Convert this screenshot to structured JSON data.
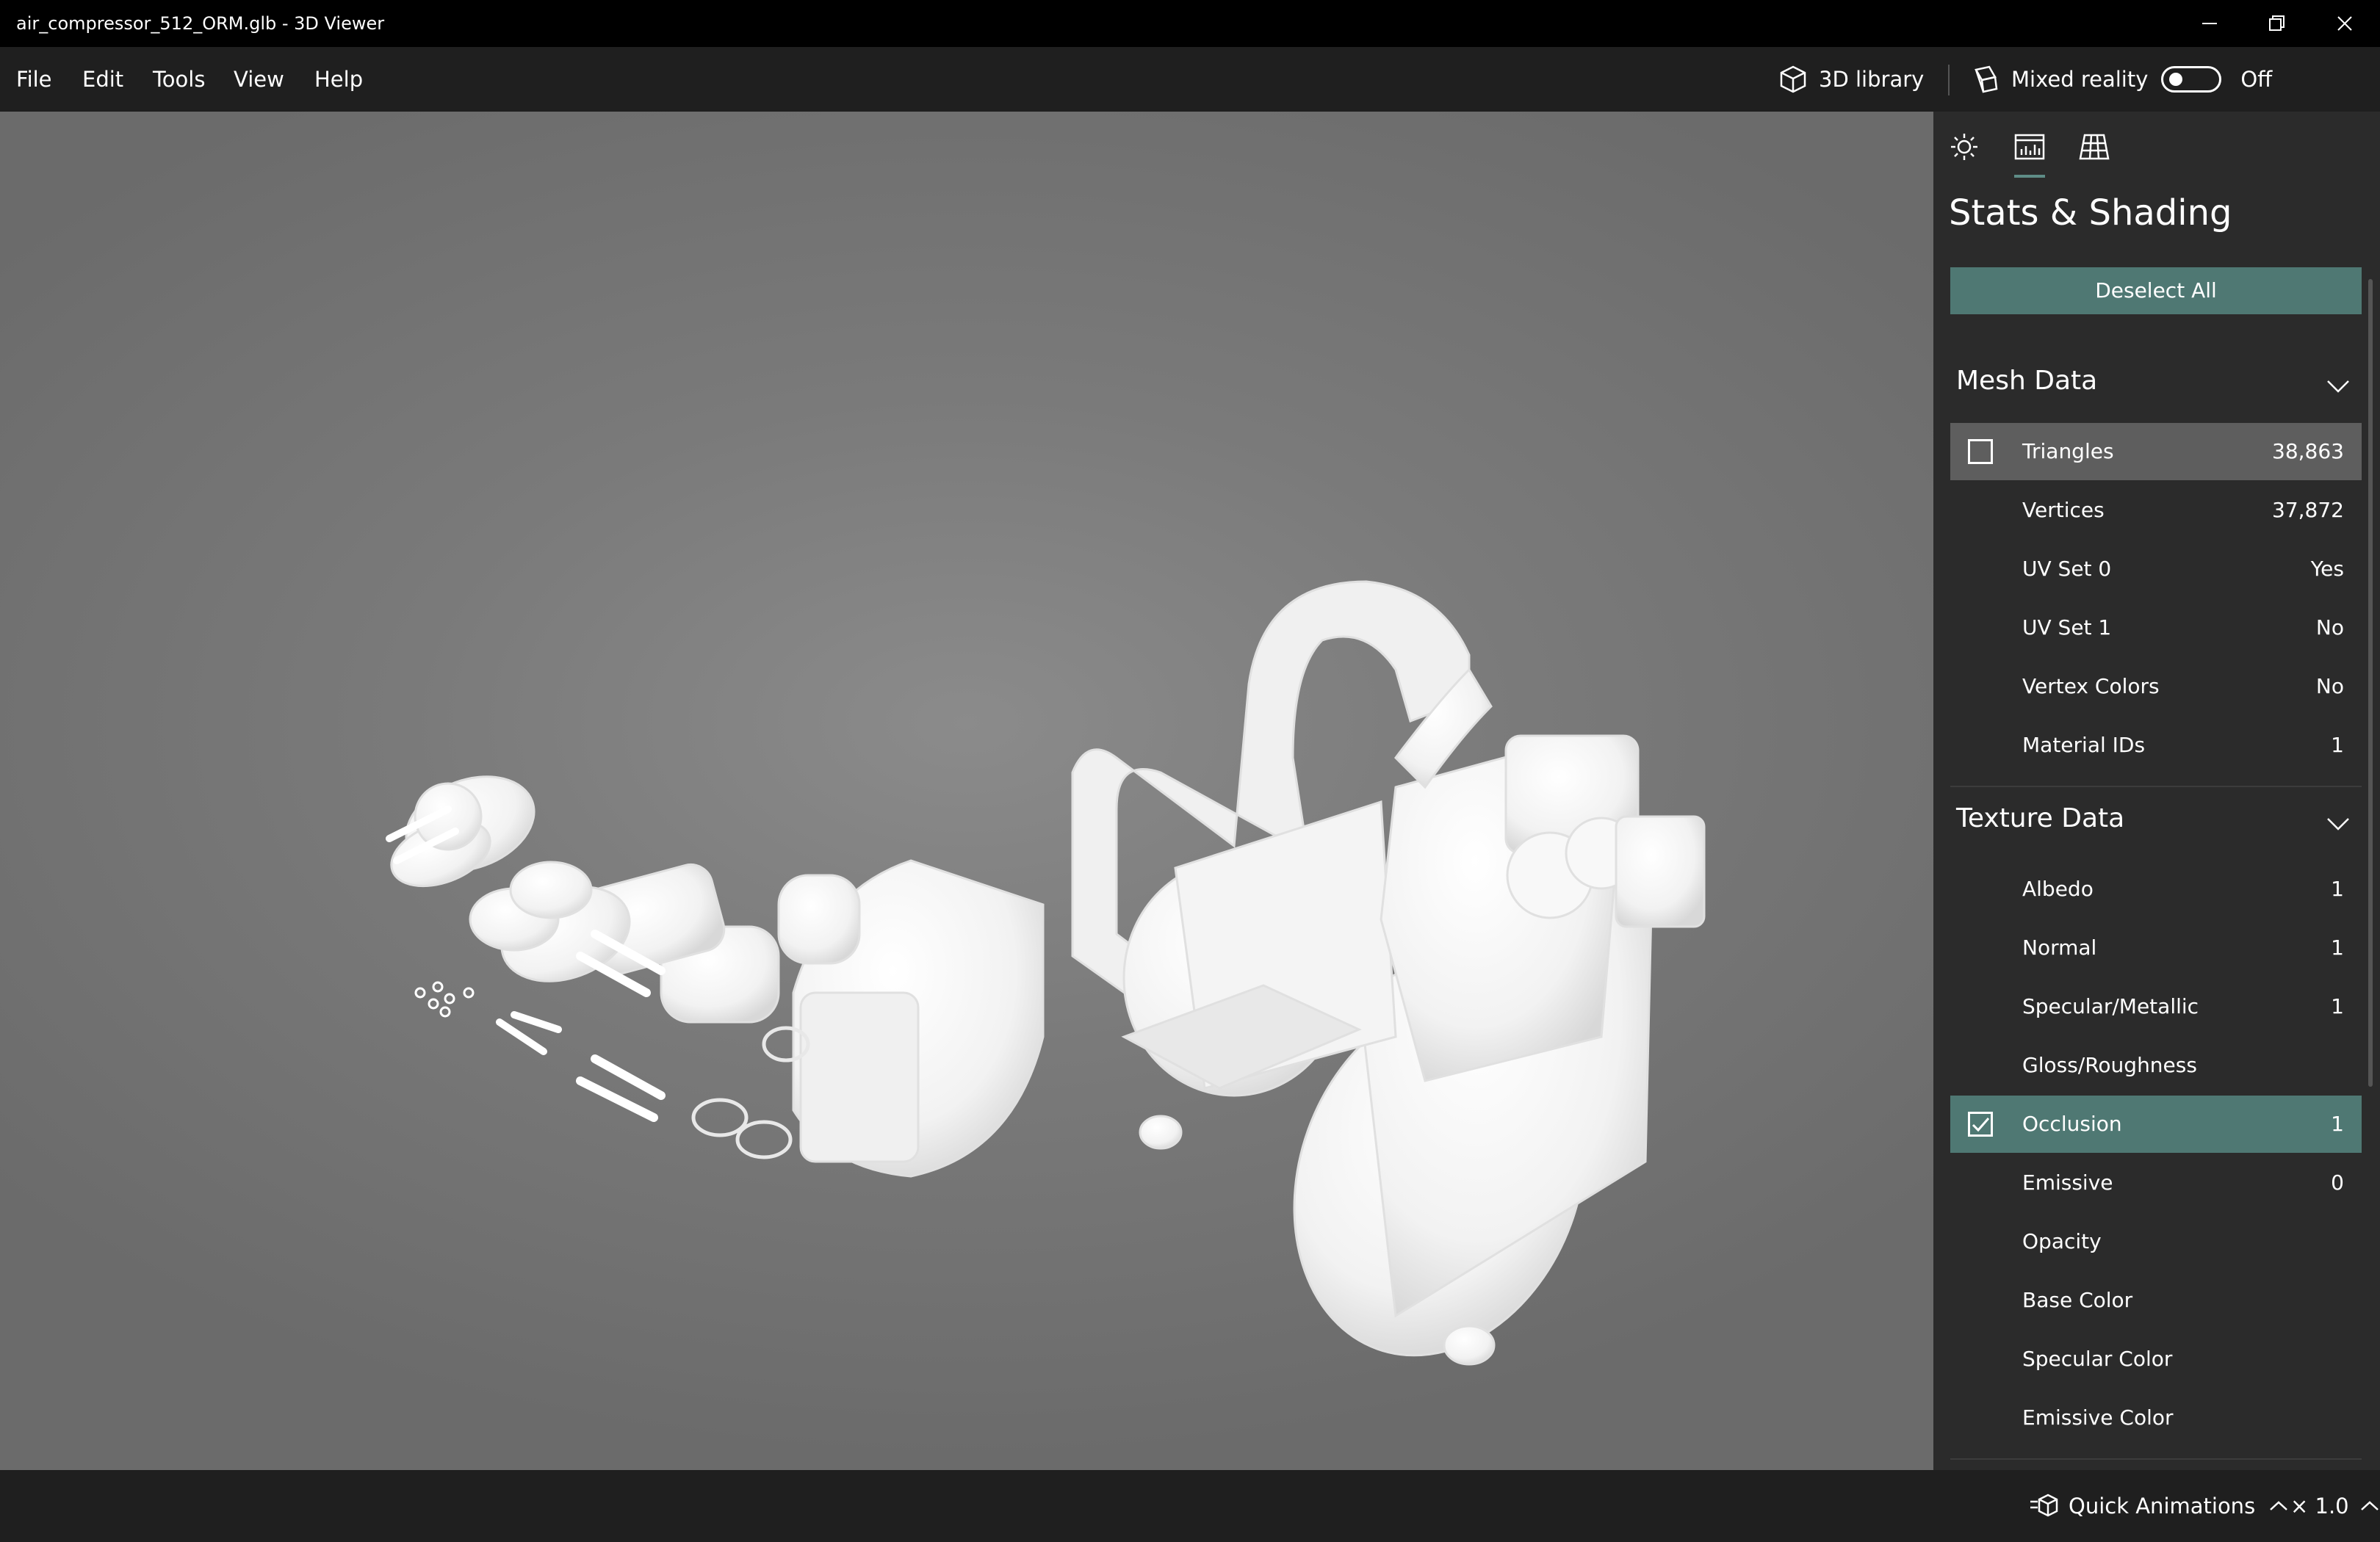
{
  "window": {
    "title": "air_compressor_512_ORM.glb - 3D Viewer",
    "controls": [
      "minimize-icon",
      "restore-icon",
      "close-icon"
    ]
  },
  "menu": {
    "file": "File",
    "edit": "Edit",
    "tools": "Tools",
    "view": "View",
    "help": "Help"
  },
  "toolbar": {
    "library_label": "3D library",
    "mixed_reality_label": "Mixed reality",
    "mixed_reality_state": "Off"
  },
  "panel": {
    "tabs": [
      "sun-icon",
      "stats-icon",
      "grid-icon"
    ],
    "active_tab": "stats-icon",
    "title": "Stats & Shading",
    "deselect_label": "Deselect All",
    "mesh": {
      "header": "Mesh Data",
      "rows": [
        {
          "label": "Triangles",
          "value": "38,863",
          "checkbox": true,
          "checked": false,
          "state": "hover"
        },
        {
          "label": "Vertices",
          "value": "37,872"
        },
        {
          "label": "UV Set 0",
          "value": "Yes"
        },
        {
          "label": "UV Set 1",
          "value": "No"
        },
        {
          "label": "Vertex Colors",
          "value": "No"
        },
        {
          "label": "Material IDs",
          "value": "1"
        }
      ]
    },
    "texture": {
      "header": "Texture Data",
      "rows": [
        {
          "label": "Albedo",
          "value": "1"
        },
        {
          "label": "Normal",
          "value": "1"
        },
        {
          "label": "Specular/Metallic",
          "value": "1"
        },
        {
          "label": "Gloss/Roughness",
          "value": ""
        },
        {
          "label": "Occlusion",
          "value": "1",
          "checkbox": true,
          "checked": true,
          "state": "selected"
        },
        {
          "label": "Emissive",
          "value": "0"
        },
        {
          "label": "Opacity",
          "value": ""
        },
        {
          "label": "Base Color",
          "value": ""
        },
        {
          "label": "Specular Color",
          "value": ""
        },
        {
          "label": "Emissive Color",
          "value": ""
        }
      ]
    }
  },
  "bottom": {
    "animations_label": "Quick Animations",
    "speed_label": "× 1.0"
  },
  "colors": {
    "accent": "#4f7873",
    "panel_bg": "#2b2b2b",
    "titlebar_bg": "#000000",
    "viewport_bg": "#7a7a7a"
  }
}
